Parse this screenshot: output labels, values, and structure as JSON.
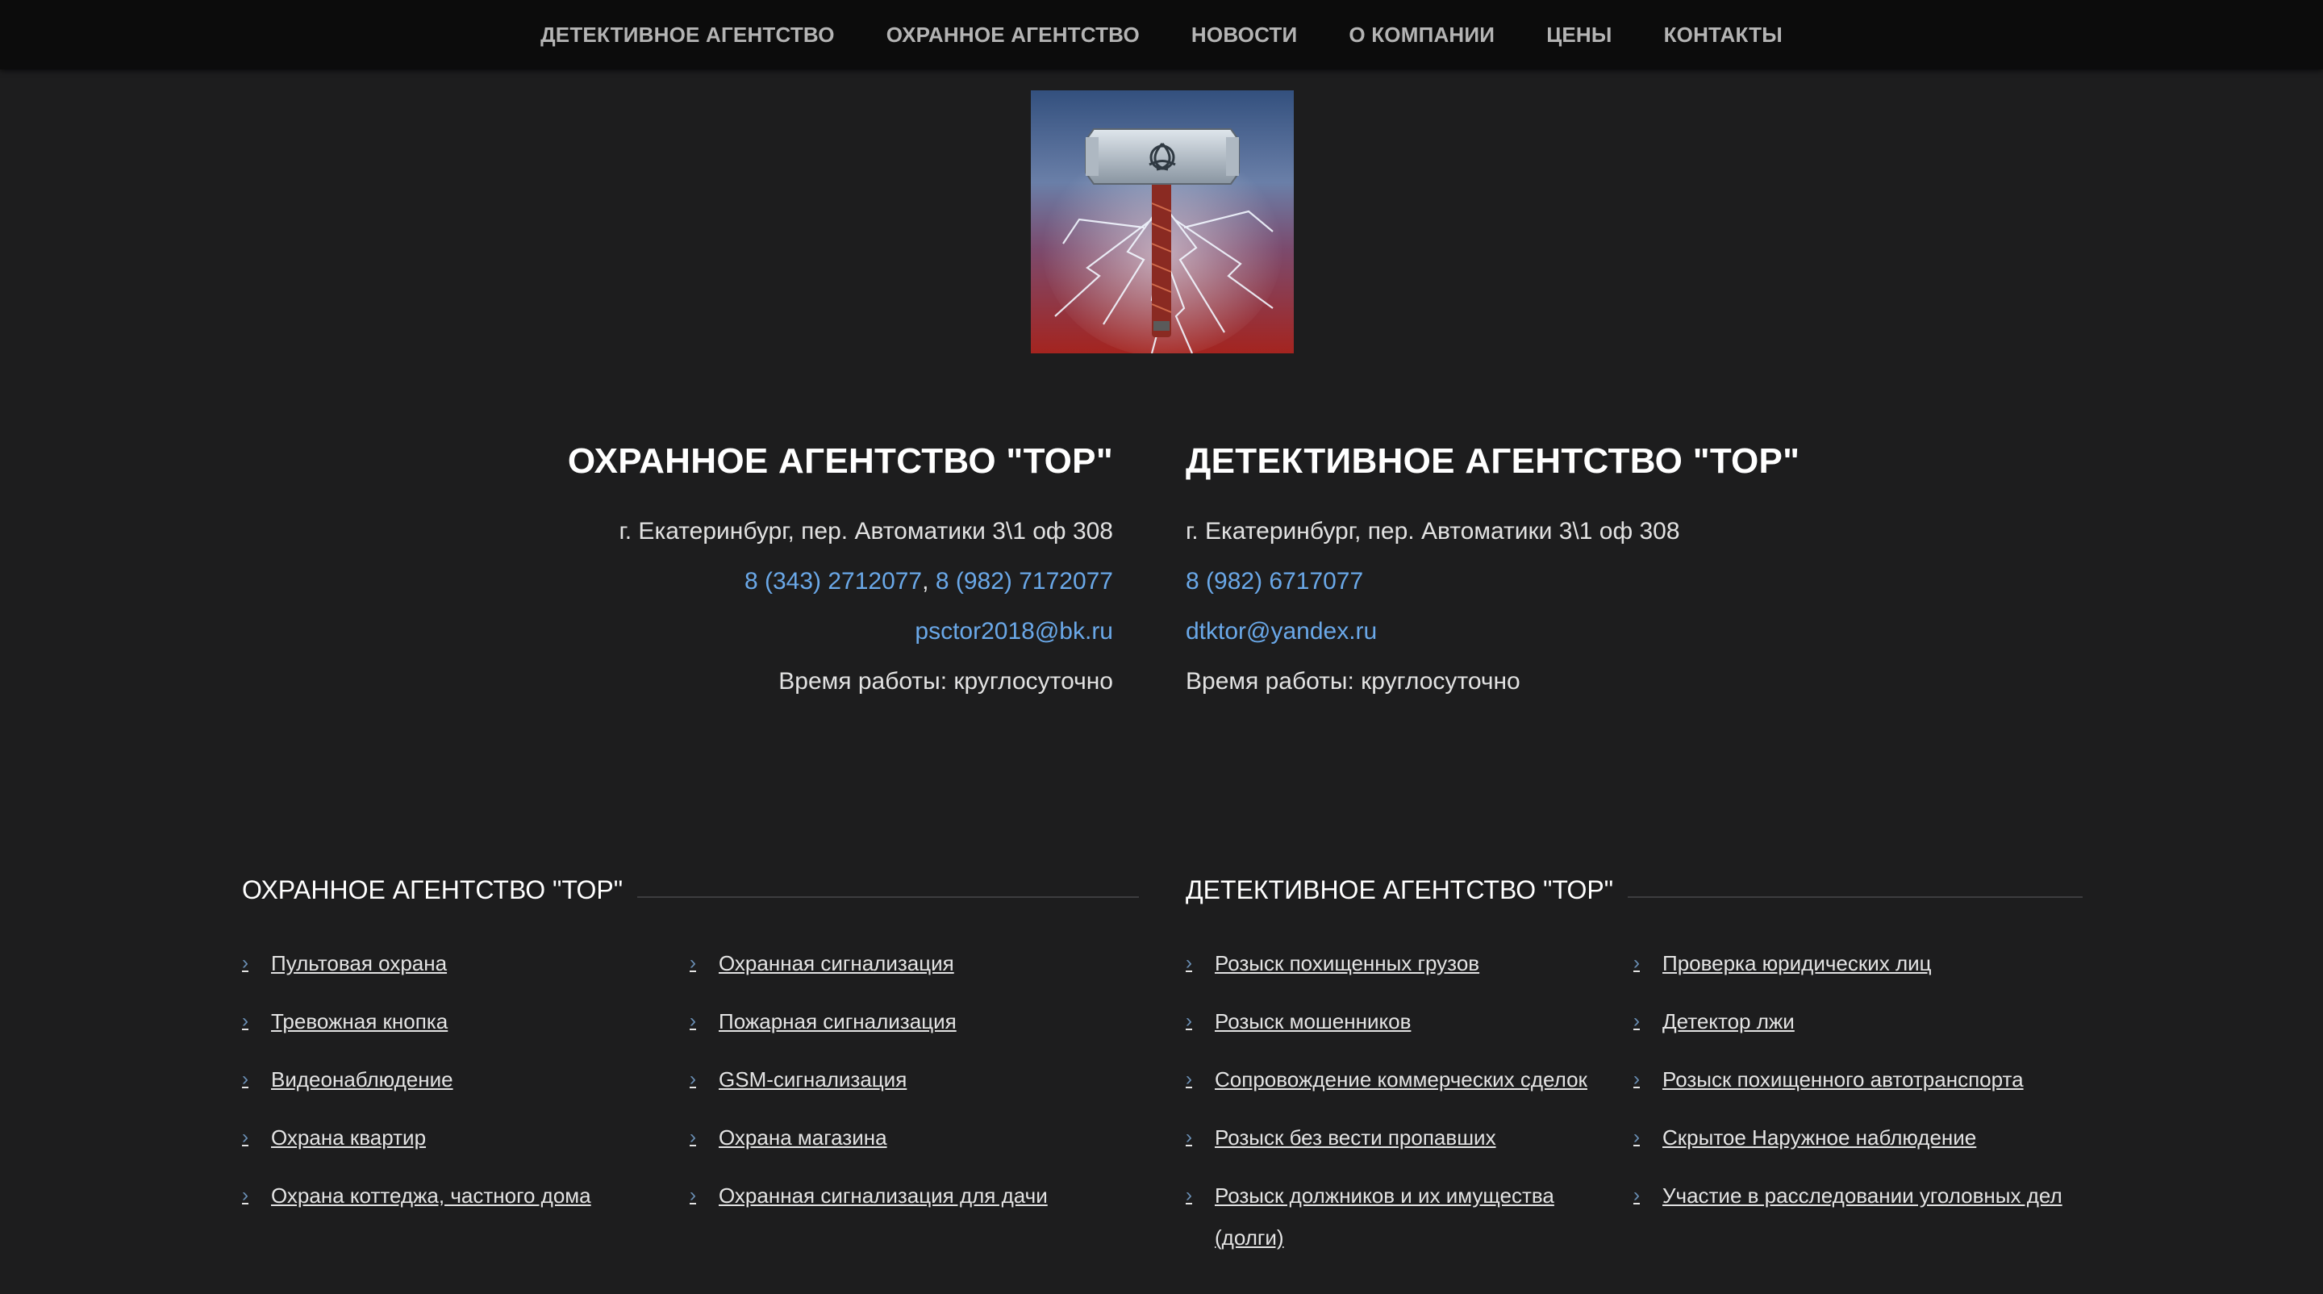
{
  "nav": {
    "items": [
      {
        "label": "ДЕТЕКТИВНОЕ АГЕНТСТВО"
      },
      {
        "label": "ОХРАННОЕ АГЕНТСТВО"
      },
      {
        "label": "НОВОСТИ"
      },
      {
        "label": "О КОМПАНИИ"
      },
      {
        "label": "ЦЕНЫ"
      },
      {
        "label": "КОНТАКТЫ"
      }
    ]
  },
  "logo": {
    "icon": "thor-hammer-lightning-logo",
    "colors": {
      "sky_top": "#3a5a8c",
      "sky_bottom": "#a12a23",
      "hammer": "#b9c3cc",
      "lightning": "#eaf2ff"
    }
  },
  "security": {
    "title": "ОХРАННОЕ АГЕНТСТВО \"ТОР\"",
    "address": "г. Екатеринбург, пер. Автоматики 3\\1 оф 308",
    "phone1": "8 (343) 2712077",
    "phone_separator": ",",
    "phone2": "8 (982) 7172077",
    "email": "psctor2018@bk.ru",
    "hours": "Время работы: круглосуточно"
  },
  "detective": {
    "title": "ДЕТЕКТИВНОЕ АГЕНТСТВО \"ТОР\"",
    "address": "г. Екатеринбург, пер. Автоматики 3\\1 оф 308",
    "phone": "8 (982) 6717077",
    "email": "dtktor@yandex.ru",
    "hours": "Время работы: круглосуточно"
  },
  "security_services": {
    "title": "ОХРАННОЕ АГЕНТСТВО \"ТОР\"",
    "items": [
      "Пультовая охрана",
      "Охранная сигнализация",
      "Тревожная кнопка",
      "Пожарная сигнализация",
      "Видеонаблюдение",
      "GSM-сигнализация",
      "Охрана квартир",
      "Охрана магазина",
      "Охрана коттеджа, частного дома",
      "Охранная сигнализация для дачи"
    ]
  },
  "detective_services": {
    "title": "ДЕТЕКТИВНОЕ АГЕНТСТВО \"ТОР\"",
    "items": [
      "Розыск похищенных грузов",
      "Проверка юридических лиц",
      "Розыск мошенников",
      "Детектор лжи",
      "Сопровождение коммерческих сделок",
      "Розыск похищенного автотранспорта",
      "Розыск без вести пропавших",
      "Скрытое Наружное наблюдение",
      "Розыск должников и их имущества (долги)",
      "Участие в расследовании уголовных дел"
    ]
  },
  "colors": {
    "background": "#1d1d1e",
    "nav_background": "#0c0c0c",
    "link": "#6aa8e8",
    "chevron": "#6a8fb5"
  },
  "icons": {
    "list_bullet": "chevron-right-icon"
  }
}
